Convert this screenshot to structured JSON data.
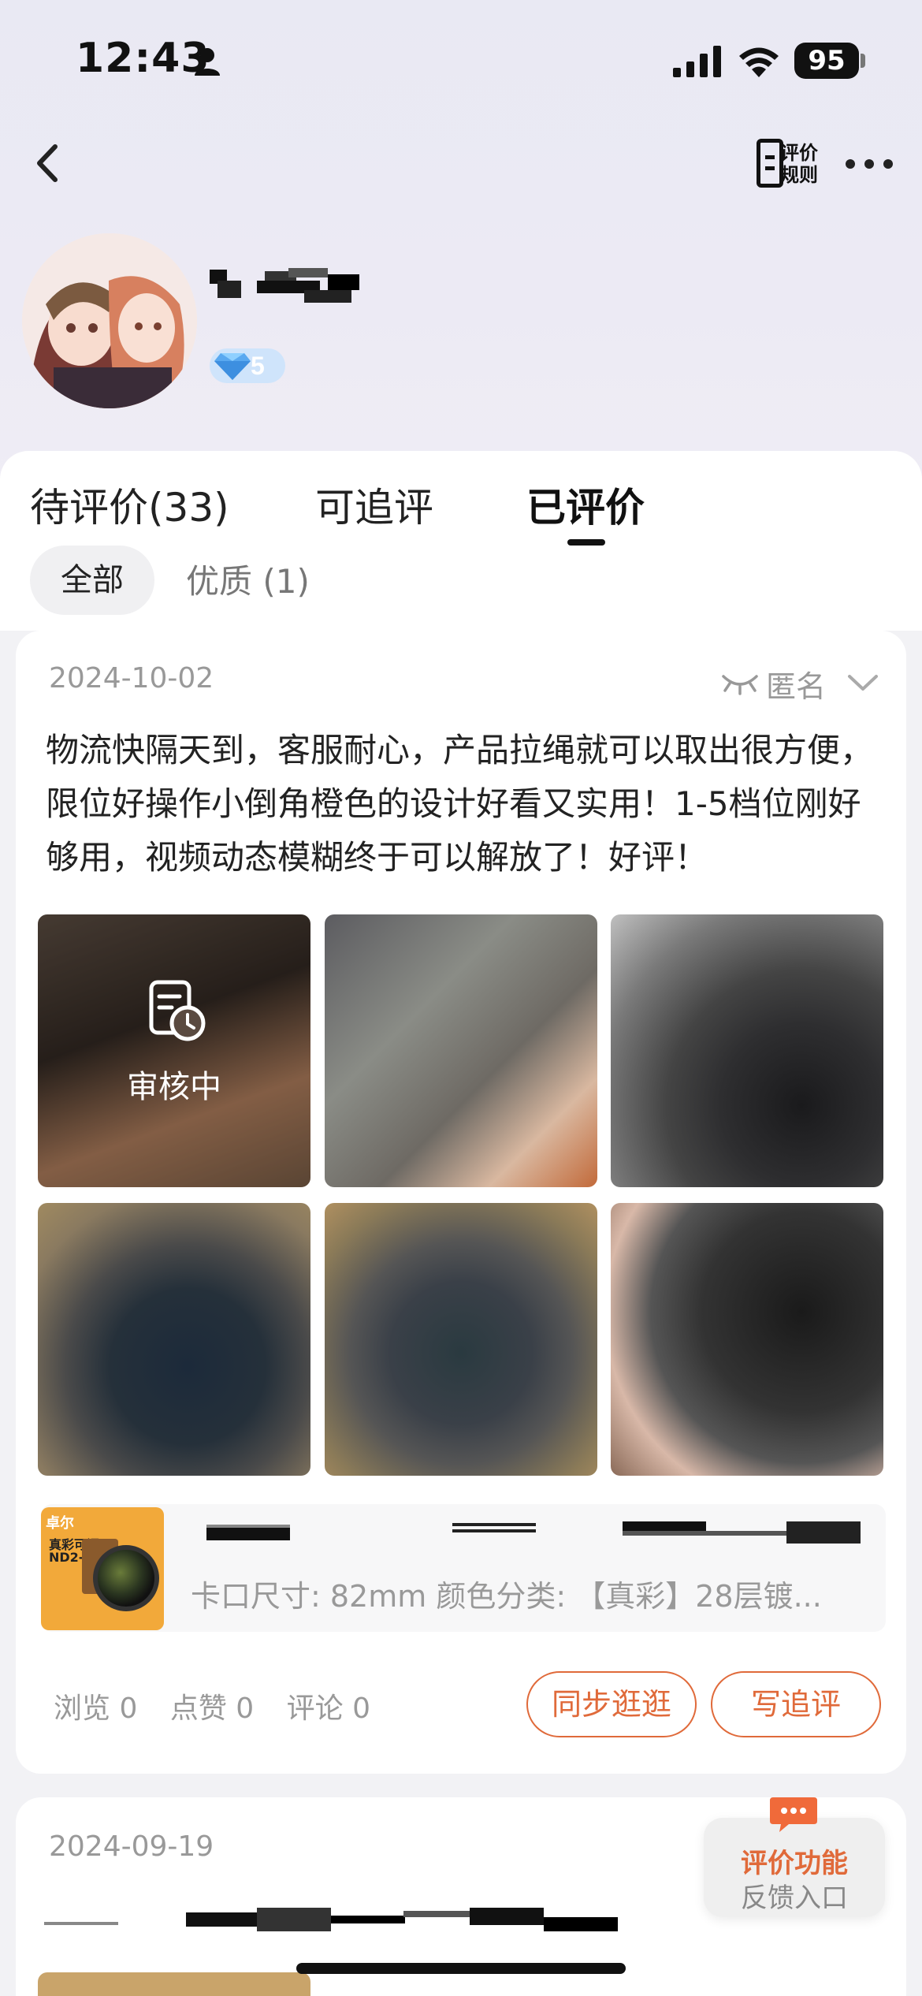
{
  "status_bar": {
    "time": "12:43",
    "battery": "95"
  },
  "nav": {
    "rules_label_line1": "评价",
    "rules_label_line2": "规则",
    "back_icon": "chevron-left-icon",
    "more_icon": "ellipsis-icon"
  },
  "profile": {
    "level": "5"
  },
  "tabs": [
    {
      "label": "待评价(33)"
    },
    {
      "label": "可追评"
    },
    {
      "label": "已评价"
    }
  ],
  "filters": [
    {
      "label": "全部"
    },
    {
      "label": "优质 (1)"
    }
  ],
  "review1": {
    "date": "2024-10-02",
    "anonymous_label": "匿名",
    "text": "物流快隔天到，客服耐心，产品拉绳就可以取出很方便，限位好操作小倒角橙色的设计好看又实用！1-5档位刚好够用，视频动态模糊终于可以解放了！好评！",
    "photo_status": "审核中",
    "product": {
      "thumb_brand": "卓尔",
      "thumb_line1": "真彩可调",
      "thumb_line2": "ND2-32",
      "spec": "卡口尺寸: 82mm 颜色分类: 【真彩】28层镀..."
    },
    "stats": {
      "views": "浏览 0",
      "likes": "点赞 0",
      "comments": "评论 0"
    },
    "buttons": {
      "sync": "同步逛逛",
      "followup": "写追评"
    }
  },
  "review2": {
    "date": "2024-09-19"
  },
  "feedback": {
    "line1": "评价功能",
    "line2": "反馈入口"
  },
  "colors": {
    "accent": "#e06a3a",
    "muted": "#999999"
  }
}
